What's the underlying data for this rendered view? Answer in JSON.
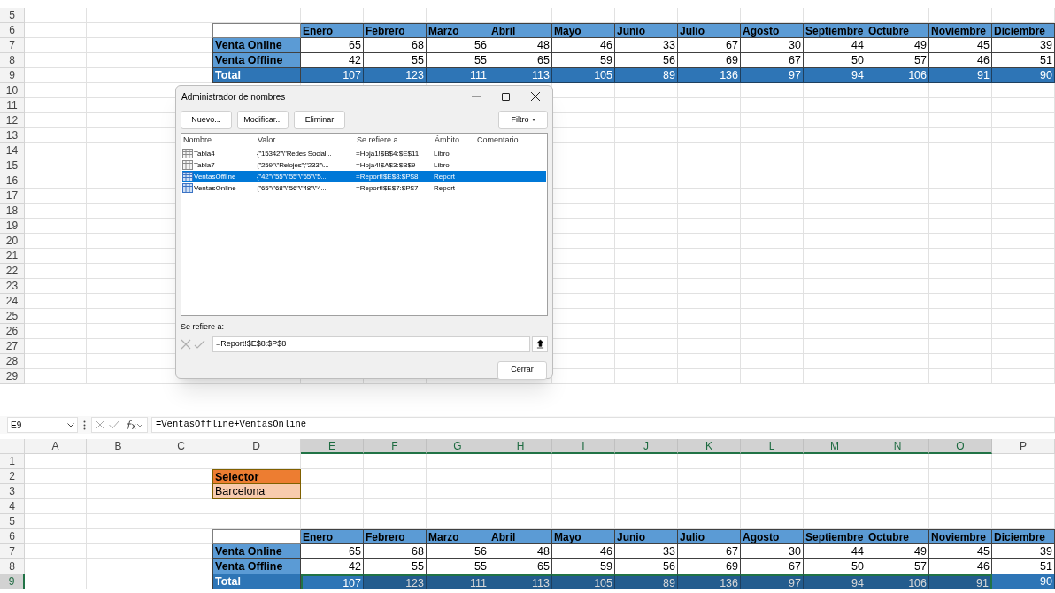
{
  "top_sheet": {
    "row_numbers": [
      "5",
      "6",
      "7",
      "8",
      "9",
      "10",
      "11",
      "12",
      "13",
      "14",
      "15",
      "16",
      "17",
      "18",
      "19",
      "20",
      "21",
      "22",
      "23",
      "24",
      "25",
      "26",
      "27",
      "28",
      "29"
    ],
    "table": {
      "columns": [
        "Enero",
        "Febrero",
        "Marzo",
        "Abril",
        "Mayo",
        "Junio",
        "Julio",
        "Agosto",
        "Septiembre",
        "Octubre",
        "Noviembre",
        "Diciembre"
      ],
      "rows": [
        {
          "kind": "data",
          "label": "Venta Online",
          "values": [
            "65",
            "68",
            "56",
            "48",
            "46",
            "33",
            "67",
            "30",
            "44",
            "49",
            "45",
            "39"
          ]
        },
        {
          "kind": "data",
          "label": "Venta Offline",
          "values": [
            "42",
            "55",
            "55",
            "65",
            "59",
            "56",
            "69",
            "67",
            "50",
            "57",
            "46",
            "51"
          ]
        },
        {
          "kind": "total",
          "label": "Total",
          "values": [
            "107",
            "123",
            "111",
            "113",
            "105",
            "89",
            "136",
            "97",
            "94",
            "106",
            "91",
            "90"
          ]
        }
      ]
    }
  },
  "dialog": {
    "title": "Administrador de nombres",
    "buttons": [
      "Nuevo...",
      "Modificar...",
      "Eliminar"
    ],
    "filter_button": "Filtro",
    "columns": [
      "Nombre",
      "Valor",
      "Se refiere a",
      "Ámbito",
      "Comentario"
    ],
    "names": [
      {
        "kind": "table",
        "name": "Tabla4",
        "value": "{\"15342\"\\\"Redes Social...",
        "refers_to": "=Hoja1!$B$4:$E$11",
        "scope": "Libro",
        "selected": false
      },
      {
        "kind": "table",
        "name": "Tabla7",
        "value": "{\"259\"\\\"Relojes\";\"233\"\\...",
        "refers_to": "=Hoja4!$A$3:$B$9",
        "scope": "Libro",
        "selected": false
      },
      {
        "kind": "range",
        "name": "VentasOffline",
        "value": "{\"42\"\\\"55\"\\\"55\"\\\"65\"\\\"5...",
        "refers_to": "=Report!$E$8:$P$8",
        "scope": "Report",
        "selected": true
      },
      {
        "kind": "range",
        "name": "VentasOnline",
        "value": "{\"65\"\\\"68\"\\\"56\"\\\"48\"\\\"4...",
        "refers_to": "=Report!$E$7:$P$7",
        "scope": "Report",
        "selected": false
      }
    ],
    "refers_label": "Se refiere a:",
    "refers_value": "=Report!$E$8:$P$8",
    "close_button": "Cerrar"
  },
  "bottom_sheet": {
    "name_box": "E9",
    "formula": "=VentasOffline+VentasOnline",
    "column_headers": [
      {
        "label": "A",
        "selected": false
      },
      {
        "label": "B",
        "selected": false
      },
      {
        "label": "C",
        "selected": false
      },
      {
        "label": "D",
        "selected": false
      },
      {
        "label": "E",
        "selected": true
      },
      {
        "label": "F",
        "selected": true
      },
      {
        "label": "G",
        "selected": true
      },
      {
        "label": "H",
        "selected": true
      },
      {
        "label": "I",
        "selected": true
      },
      {
        "label": "J",
        "selected": true
      },
      {
        "label": "K",
        "selected": true
      },
      {
        "label": "L",
        "selected": true
      },
      {
        "label": "M",
        "selected": true
      },
      {
        "label": "N",
        "selected": true
      },
      {
        "label": "O",
        "selected": true
      },
      {
        "label": "P",
        "selected": false
      }
    ],
    "row_numbers": [
      {
        "label": "1",
        "selected": false
      },
      {
        "label": "2",
        "selected": false
      },
      {
        "label": "3",
        "selected": false
      },
      {
        "label": "4",
        "selected": false
      },
      {
        "label": "5",
        "selected": false
      },
      {
        "label": "6",
        "selected": false
      },
      {
        "label": "7",
        "selected": false
      },
      {
        "label": "8",
        "selected": false
      },
      {
        "label": "9",
        "selected": true
      }
    ],
    "selector_header": "Selector",
    "selector_value": "Barcelona",
    "table": {
      "columns": [
        "Enero",
        "Febrero",
        "Marzo",
        "Abril",
        "Mayo",
        "Junio",
        "Julio",
        "Agosto",
        "Septiembre",
        "Octubre",
        "Noviembre",
        "Diciembre"
      ],
      "rows": [
        {
          "kind": "data",
          "label": "Venta Online",
          "values": [
            "65",
            "68",
            "56",
            "48",
            "46",
            "33",
            "67",
            "30",
            "44",
            "49",
            "45",
            "39"
          ]
        },
        {
          "kind": "data",
          "label": "Venta Offline",
          "values": [
            "42",
            "55",
            "55",
            "65",
            "59",
            "56",
            "69",
            "67",
            "50",
            "57",
            "46",
            "51"
          ]
        },
        {
          "kind": "total",
          "label": "Total",
          "values": [
            "107",
            "123",
            "111",
            "113",
            "105",
            "89",
            "136",
            "97",
            "94",
            "106",
            "91",
            "90"
          ],
          "selected": [
            true,
            true,
            true,
            true,
            true,
            true,
            true,
            true,
            true,
            true,
            true,
            false
          ],
          "active": [
            true,
            false,
            false,
            false,
            false,
            false,
            false,
            false,
            false,
            false,
            false,
            false
          ]
        }
      ]
    }
  }
}
